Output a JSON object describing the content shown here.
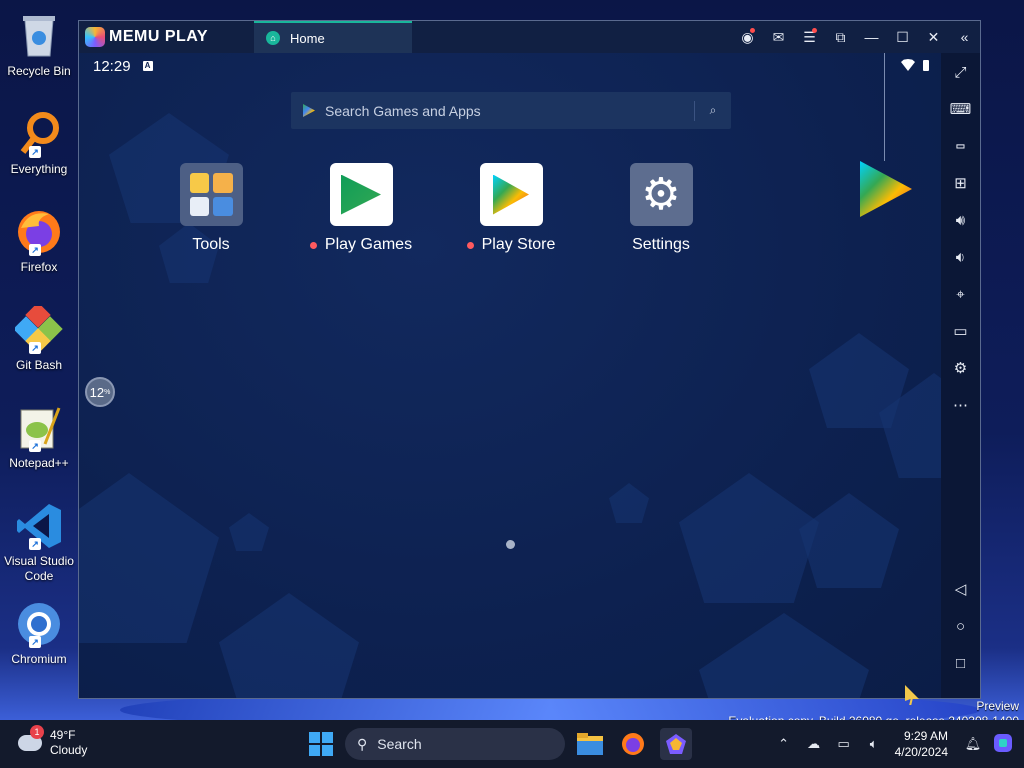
{
  "desktop": {
    "icons": [
      {
        "label": "Recycle Bin"
      },
      {
        "label": "Everything"
      },
      {
        "label": "Firefox"
      },
      {
        "label": "Git Bash"
      },
      {
        "label": "Notepad++"
      },
      {
        "label": "Visual Studio Code"
      },
      {
        "label": "Chromium"
      }
    ]
  },
  "memu": {
    "brand": "MEMU PLAY",
    "tab_label": "Home",
    "status": {
      "time": "12:29",
      "badge": "A"
    },
    "search": {
      "placeholder": "Search Games and Apps"
    },
    "apps": [
      {
        "label": "Tools"
      },
      {
        "label": "Play Games"
      },
      {
        "label": "Play Store"
      },
      {
        "label": "Settings"
      }
    ],
    "progress_value": "12",
    "progress_unit": "%"
  },
  "watermark": {
    "line1": "Preview",
    "line2": "Evaluation copy. Build 26080.ge_release.240308-1400"
  },
  "taskbar": {
    "weather_temp": "49°F",
    "weather_cond": "Cloudy",
    "weather_badge": "1",
    "search_label": "Search",
    "time": "9:29 AM",
    "date": "4/20/2024"
  },
  "colors": {
    "accent_tab": "#19b69b",
    "notification_dot": "#ff5a5f"
  }
}
